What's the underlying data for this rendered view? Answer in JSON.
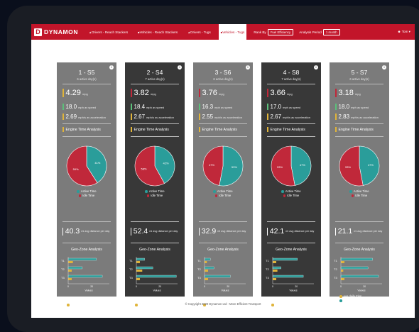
{
  "nav": {
    "logo_mark": "D",
    "logo": "DYNAMON",
    "items": [
      {
        "icon": "user-icon",
        "label": "Drivers - Reach Stackers",
        "active": false
      },
      {
        "icon": "truck-icon",
        "label": "Vehicles - Reach Stackers",
        "active": false
      },
      {
        "icon": "user-icon",
        "label": "Drivers - Tugs",
        "active": false
      },
      {
        "icon": "truck-icon",
        "label": "Vehicles - Tugs",
        "active": true
      }
    ],
    "rank_label": "Rank By",
    "rank_value": "Fuel Efficiency",
    "period_label": "Analysis Period",
    "period_value": "1 month",
    "user": "Tom"
  },
  "colors": {
    "brand": "#c2152a",
    "active": "#2a9d9a",
    "idle": "#c0283a",
    "accent": "#e0b43a",
    "light_card": "#7b7b7b",
    "dark_card": "#383838"
  },
  "labels": {
    "engine": "Engine Time Analysis",
    "active": "Active Time",
    "idle": "Idle Time",
    "geo": "Geo-Zone Analysis",
    "values": "Values",
    "trips": "avg daily trips",
    "time_in_zone": "avg time in zone (m)",
    "mpg": "mpg",
    "speed": "mph av speed",
    "accel": "mph/s av acceleration",
    "dist": "mi avg distance per day"
  },
  "cards": [
    {
      "title": "1 - S5",
      "sub": "6 active day(s)",
      "mpg": "4.29",
      "speed": "18.0",
      "accel": "2.69",
      "active_pct": 41,
      "idle_pct": 59,
      "dist": "40.3",
      "trips": [
        4,
        3,
        3
      ],
      "zone": [
        24,
        12,
        29
      ],
      "theme": "light",
      "extra_legend": false,
      "mpg_color": "#e0b43a",
      "speed_color": "#5cc07a",
      "accel_color": "#e0b43a"
    },
    {
      "title": "2 - S4",
      "sub": "7 active day(s)",
      "mpg": "3.82",
      "speed": "18.4",
      "accel": "2.67",
      "active_pct": 42,
      "idle_pct": 58,
      "dist": "52.4",
      "trips": [
        3,
        5,
        3
      ],
      "zone": [
        7,
        14,
        34
      ],
      "theme": "dark",
      "extra_legend": false,
      "mpg_color": "#c0283a",
      "speed_color": "#5cc07a",
      "accel_color": "#e0b43a"
    },
    {
      "title": "3 - S6",
      "sub": "6 active day(s)",
      "mpg": "3.76",
      "speed": "16.3",
      "accel": "2.55",
      "active_pct": 53,
      "idle_pct": 47,
      "dist": "32.9",
      "trips": [
        2,
        3,
        3
      ],
      "zone": [
        5,
        8,
        22
      ],
      "theme": "light",
      "extra_legend": false,
      "mpg_color": "#c0283a",
      "speed_color": "#5cc07a",
      "accel_color": "#e0b43a"
    },
    {
      "title": "4 - S8",
      "sub": "7 active day(s)",
      "mpg": "3.66",
      "speed": "17.0",
      "accel": "2.67",
      "active_pct": 47,
      "idle_pct": 53,
      "dist": "42.1",
      "trips": [
        3,
        4,
        3
      ],
      "zone": [
        21,
        7,
        26
      ],
      "theme": "dark",
      "extra_legend": false,
      "mpg_color": "#c0283a",
      "speed_color": "#5cc07a",
      "accel_color": "#e0b43a"
    },
    {
      "title": "5 - S7",
      "sub": "6 active day(s)",
      "mpg": "3.18",
      "speed": "18.0",
      "accel": "2.83",
      "active_pct": 47,
      "idle_pct": 53,
      "dist": "21.1",
      "trips": [
        3,
        2,
        3
      ],
      "zone": [
        27,
        23,
        32
      ],
      "theme": "light",
      "extra_legend": true,
      "mpg_color": "#c0283a",
      "speed_color": "#5cc07a",
      "accel_color": "#e0b43a"
    }
  ],
  "footer": "© Copyright 2020 Dynamon Ltd - More Efficient Transport"
}
